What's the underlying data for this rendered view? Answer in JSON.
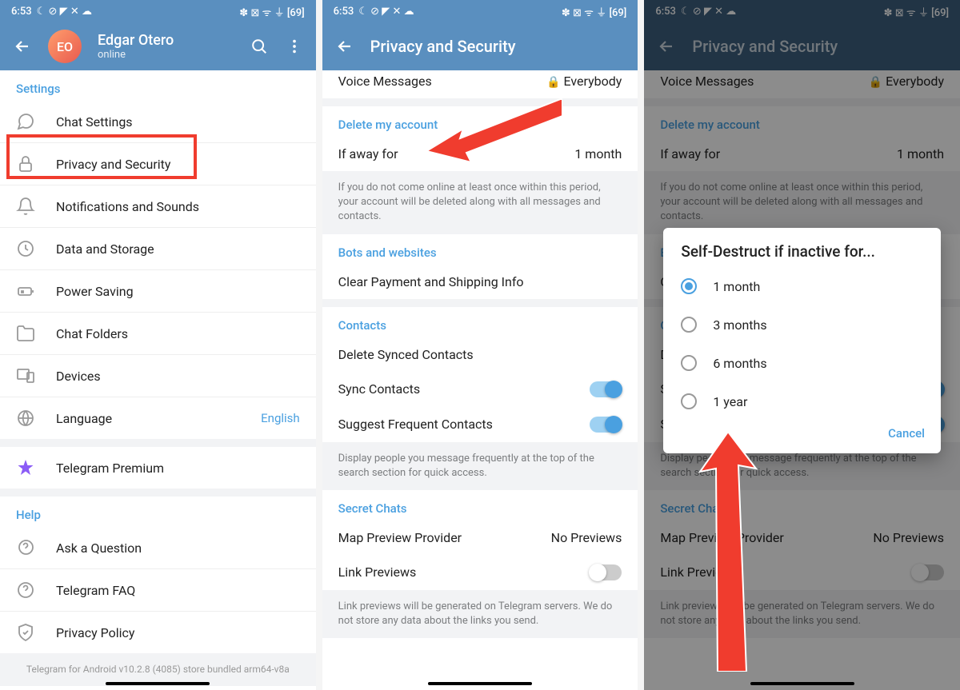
{
  "status": {
    "time": "6:53",
    "icons_right": "✽ ⊠ ᯤ ⏚ [69]"
  },
  "screen1": {
    "avatar": "EO",
    "name": "Edgar Otero",
    "status": "online",
    "settings_title": "Settings",
    "items": [
      {
        "icon": "chat",
        "label": "Chat Settings"
      },
      {
        "icon": "lock",
        "label": "Privacy and Security"
      },
      {
        "icon": "bell",
        "label": "Notifications and Sounds"
      },
      {
        "icon": "data",
        "label": "Data and Storage"
      },
      {
        "icon": "power",
        "label": "Power Saving"
      },
      {
        "icon": "folder",
        "label": "Chat Folders"
      },
      {
        "icon": "devices",
        "label": "Devices"
      },
      {
        "icon": "globe",
        "label": "Language",
        "value": "English"
      }
    ],
    "premium": "Telegram Premium",
    "help_title": "Help",
    "help_items": [
      {
        "icon": "question",
        "label": "Ask a Question"
      },
      {
        "icon": "faq",
        "label": "Telegram FAQ"
      },
      {
        "icon": "shield",
        "label": "Privacy Policy"
      }
    ],
    "footer": "Telegram for Android v10.2.8 (4085) store bundled arm64-v8a"
  },
  "screen2": {
    "title": "Privacy and Security",
    "voice_msgs": "Voice Messages",
    "everybody": "Everybody",
    "delete_header": "Delete my account",
    "if_away": "If away for",
    "if_away_value": "1 month",
    "delete_help": "If you do not come online at least once within this period, your account will be deleted along with all messages and contacts.",
    "bots_header": "Bots and websites",
    "clear_payment": "Clear Payment and Shipping Info",
    "contacts_header": "Contacts",
    "delete_synced": "Delete Synced Contacts",
    "sync_contacts": "Sync Contacts",
    "suggest_freq": "Suggest Frequent Contacts",
    "suggest_help": "Display people you message frequently at the top of the search section for quick access.",
    "secret_header": "Secret Chats",
    "map_preview": "Map Preview Provider",
    "no_previews": "No Previews",
    "link_previews": "Link Previews",
    "link_help": "Link previews will be generated on Telegram servers. We do not store any data about the links you send."
  },
  "dialog": {
    "title": "Self-Destruct if inactive for...",
    "options": [
      "1 month",
      "3 months",
      "6 months",
      "1 year"
    ],
    "selected": 0,
    "cancel": "Cancel"
  }
}
